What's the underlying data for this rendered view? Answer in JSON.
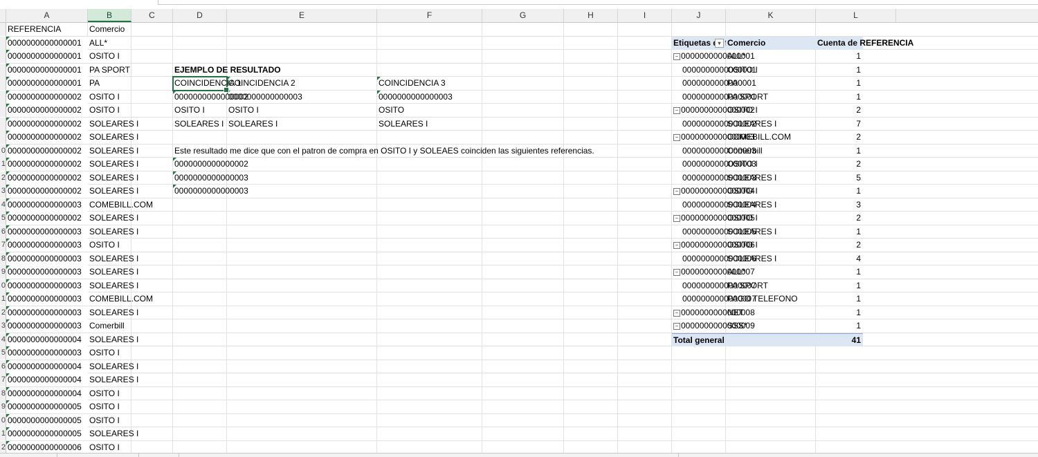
{
  "columns": [
    "A",
    "B",
    "C",
    "D",
    "E",
    "F",
    "G",
    "H",
    "I",
    "J",
    "K",
    "L"
  ],
  "row_numbers_visible": [
    "",
    "",
    "",
    "",
    "",
    "",
    "",
    "",
    "",
    "0",
    "1",
    "2",
    "3",
    "4",
    "5",
    "6",
    "7",
    "8",
    "9",
    "0",
    "1",
    "2",
    "3",
    "4",
    "5",
    "6",
    "7",
    "8",
    "9",
    "0",
    "1",
    "2"
  ],
  "data_table": {
    "headers": [
      "REFERENCIA",
      "Comercio"
    ],
    "rows": [
      [
        "0000000000000001",
        "ALL*"
      ],
      [
        "0000000000000001",
        "OSITO I"
      ],
      [
        "0000000000000001",
        "PA SPORT"
      ],
      [
        "0000000000000001",
        "PA"
      ],
      [
        "0000000000000002",
        "OSITO I"
      ],
      [
        "0000000000000002",
        "OSITO I"
      ],
      [
        "0000000000000002",
        "SOLEARES I"
      ],
      [
        "0000000000000002",
        "SOLEARES I"
      ],
      [
        "0000000000000002",
        "SOLEARES I"
      ],
      [
        "0000000000000002",
        "SOLEARES I"
      ],
      [
        "0000000000000002",
        "SOLEARES I"
      ],
      [
        "0000000000000002",
        "SOLEARES I"
      ],
      [
        "0000000000000003",
        "COMEBILL.COM"
      ],
      [
        "0000000000000002",
        "SOLEARES I"
      ],
      [
        "0000000000000003",
        "SOLEARES I"
      ],
      [
        "0000000000000003",
        "OSITO I"
      ],
      [
        "0000000000000003",
        "SOLEARES I"
      ],
      [
        "0000000000000003",
        "SOLEARES I"
      ],
      [
        "0000000000000003",
        "SOLEARES I"
      ],
      [
        "0000000000000003",
        "COMEBILL.COM"
      ],
      [
        "0000000000000003",
        "SOLEARES I"
      ],
      [
        "0000000000000003",
        "Comerbill"
      ],
      [
        "0000000000000004",
        "SOLEARES I"
      ],
      [
        "0000000000000003",
        "OSITO I"
      ],
      [
        "0000000000000004",
        "SOLEARES I"
      ],
      [
        "0000000000000004",
        "SOLEARES I"
      ],
      [
        "0000000000000004",
        "OSITO I"
      ],
      [
        "0000000000000005",
        "OSITO I"
      ],
      [
        "0000000000000005",
        "OSITO I"
      ],
      [
        "0000000000000005",
        "SOLEARES I"
      ],
      [
        "0000000000000006",
        "OSITO I"
      ]
    ]
  },
  "example": {
    "title": "EJEMPLO DE RESULTADO",
    "headers": [
      "COINCIDENCIA 1",
      "COINCIDENCIA 2",
      "COINCIDENCIA 3"
    ],
    "rows": [
      [
        "0000000000000002",
        "0000000000000003",
        "0000000000000003"
      ],
      [
        "OSITO I",
        "OSITO I",
        "OSITO"
      ],
      [
        "SOLEARES  I",
        "SOLEARES I",
        "SOLEARES I"
      ]
    ],
    "note": "Este resultado me dice que con el patron de compra en OSITO I y SOLEAES coinciden las siguientes referencias.",
    "refs": [
      "0000000000000002",
      "0000000000000003",
      "0000000000000003"
    ]
  },
  "pivot": {
    "headers": [
      "Etiquetas de fila",
      "Comercio",
      "Cuenta de REFERENCIA"
    ],
    "rows": [
      {
        "ref": "0000000000000001",
        "com": "ALL*",
        "count": "1",
        "group": true
      },
      {
        "ref": "0000000000000001",
        "com": "OSITO I",
        "count": "1",
        "group": false
      },
      {
        "ref": "0000000000000001",
        "com": "PA",
        "count": "1",
        "group": false
      },
      {
        "ref": "0000000000000001",
        "com": "PA SPORT",
        "count": "1",
        "group": false
      },
      {
        "ref": "0000000000000002",
        "com": "OSITO I",
        "count": "2",
        "group": true
      },
      {
        "ref": "0000000000000002",
        "com": "SOLEARES I",
        "count": "7",
        "group": false
      },
      {
        "ref": "0000000000000003",
        "com": "COMEBILL.COM",
        "count": "2",
        "group": true
      },
      {
        "ref": "0000000000000003",
        "com": "Comerbill",
        "count": "1",
        "group": false
      },
      {
        "ref": "0000000000000003",
        "com": "OSITO I",
        "count": "2",
        "group": false
      },
      {
        "ref": "0000000000000003",
        "com": "SOLEARES I",
        "count": "5",
        "group": false
      },
      {
        "ref": "0000000000000004",
        "com": "OSITO I",
        "count": "1",
        "group": true
      },
      {
        "ref": "0000000000000004",
        "com": "SOLEARES I",
        "count": "3",
        "group": false
      },
      {
        "ref": "0000000000000005",
        "com": "OSITO I",
        "count": "2",
        "group": true
      },
      {
        "ref": "0000000000000005",
        "com": "SOLEARES I",
        "count": "1",
        "group": false
      },
      {
        "ref": "0000000000000006",
        "com": "OSITO I",
        "count": "2",
        "group": true
      },
      {
        "ref": "0000000000000006",
        "com": "SOLEARES I",
        "count": "4",
        "group": false
      },
      {
        "ref": "0000000000000007",
        "com": "ALL*",
        "count": "1",
        "group": true
      },
      {
        "ref": "0000000000000007",
        "com": "PA SPORT",
        "count": "1",
        "group": false
      },
      {
        "ref": "0000000000000007",
        "com": "PAGO TELEFONO",
        "count": "1",
        "group": false
      },
      {
        "ref": "0000000000000008",
        "com": "NET",
        "count": "1",
        "group": true
      },
      {
        "ref": "0000000000000009",
        "com": "SSS*",
        "count": "1",
        "group": true
      }
    ],
    "total_label": "Total general",
    "total_value": "41"
  },
  "colors": {
    "accent": "#217346",
    "pivot_header": "#dde7f4",
    "error_triangle": "#1e7b3d"
  }
}
